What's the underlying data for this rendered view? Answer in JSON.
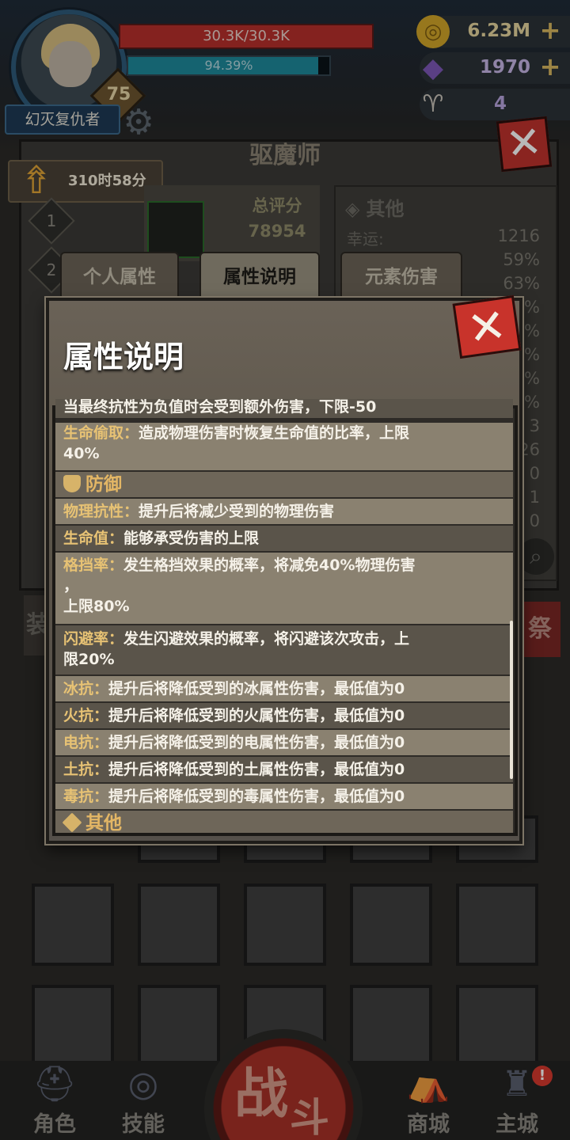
{
  "hud": {
    "name": "幻灭复仇者",
    "level": "75",
    "hp": "30.3K/30.3K",
    "xp": "94.39%",
    "xp_progress": 0.9439,
    "gold": "6.23M",
    "gems": "1970",
    "keys": "4"
  },
  "page": {
    "title": "驱魔师",
    "timer": "310时58分",
    "rank_1": "1",
    "rank_2": "2",
    "score_label": "总评分",
    "score_value": "78954",
    "other_title": "其他",
    "luck_label": "幸运:",
    "other_values": [
      "1216",
      "59%",
      "63%",
      "%",
      "%",
      "%",
      "%",
      "%",
      "3",
      "26",
      "0",
      "1",
      "0"
    ]
  },
  "tabs": [
    "个人属性",
    "属性说明",
    "元素伤害"
  ],
  "modal": {
    "title": "属性说明",
    "clipped_top": "当最终抗性为负值时会受到额外伤害，下限-50",
    "rows": [
      {
        "key": "生命偷取：",
        "text": "造成物理伤害时恢复生命值的比率，上限",
        "text2": "40%"
      },
      {
        "section": "防御"
      },
      {
        "key": "物理抗性：",
        "text": "提升后将减少受到的物理伤害"
      },
      {
        "key": "生命值：",
        "text": "能够承受伤害的上限"
      },
      {
        "key": "格挡率：",
        "text": "发生格挡效果的概率，将减免40%物理伤害",
        "text2": "，",
        "text3": "上限80%"
      },
      {
        "key": "闪避率：",
        "text": "发生闪避效果的概率，将闪避该次攻击，上",
        "text2": "限20%"
      },
      {
        "key": "冰抗：",
        "text": "提升后将降低受到的冰属性伤害，最低值为0"
      },
      {
        "key": "火抗：",
        "text": "提升后将降低受到的火属性伤害，最低值为0"
      },
      {
        "key": "电抗：",
        "text": "提升后将降低受到的电属性伤害，最低值为0"
      },
      {
        "key": "土抗：",
        "text": "提升后将降低受到的土属性伤害，最低值为0"
      },
      {
        "key": "毒抗：",
        "text": "提升后将降低受到的毒属性伤害，最低值为0"
      },
      {
        "section": "其他"
      }
    ]
  },
  "side": {
    "left_char": "装",
    "right_char": "祭"
  },
  "nav": {
    "character": "角色",
    "skills": "技能",
    "battle_1": "战",
    "battle_2": "斗",
    "shop": "商城",
    "city": "主城",
    "city_badge": "!"
  },
  "icons": {
    "gold": "coin-icon",
    "gems": "crystal-icon",
    "keys": "ram-skull-icon",
    "settings": "gear-icon",
    "close": "close-icon"
  }
}
